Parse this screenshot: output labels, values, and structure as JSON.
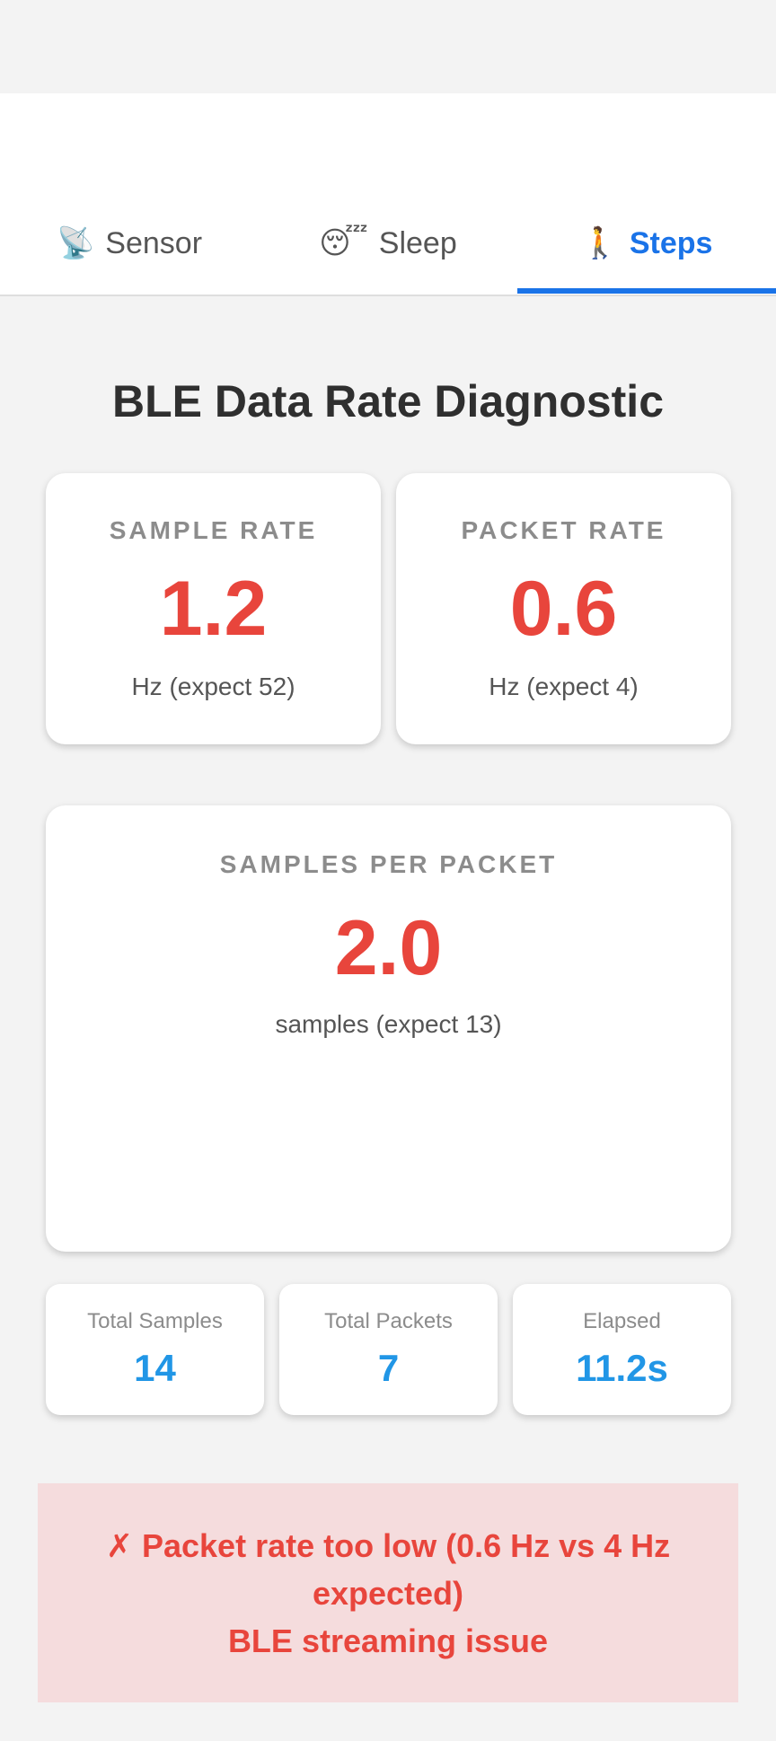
{
  "tabs": [
    {
      "icon": "📡",
      "icon_name": "satellite-antenna-icon",
      "label": "Sensor",
      "active": false
    },
    {
      "icon": "😴",
      "icon_name": "sleeping-face-icon",
      "label": "Sleep",
      "active": false
    },
    {
      "icon": "🚶",
      "icon_name": "walking-person-icon",
      "label": "Steps",
      "active": true
    }
  ],
  "page_title": "BLE Data Rate Diagnostic",
  "sample_rate": {
    "label": "SAMPLE RATE",
    "value": "1.2",
    "sub": "Hz (expect 52)"
  },
  "packet_rate": {
    "label": "PACKET RATE",
    "value": "0.6",
    "sub": "Hz (expect 4)"
  },
  "samples_per_packet": {
    "label": "SAMPLES PER PACKET",
    "value": "2.0",
    "sub": "samples (expect 13)"
  },
  "stats": {
    "total_samples": {
      "label": "Total Samples",
      "value": "14"
    },
    "total_packets": {
      "label": "Total Packets",
      "value": "7"
    },
    "elapsed": {
      "label": "Elapsed",
      "value": "11.2s"
    }
  },
  "alert": {
    "line1": "✗ Packet rate too low (0.6 Hz vs 4 Hz",
    "line2": "expected)",
    "line3": "BLE streaming issue"
  },
  "colors": {
    "accent": "#1a73e8",
    "error": "#e8453c",
    "stat_value": "#2196e6",
    "alert_bg": "#f5dcdd"
  }
}
